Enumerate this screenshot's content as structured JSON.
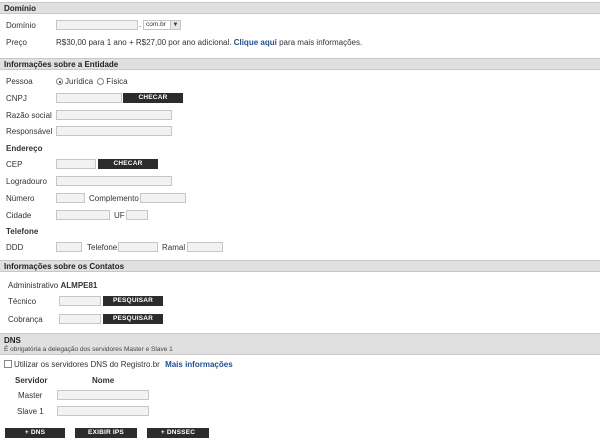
{
  "dominio": {
    "header": "Domínio",
    "label_dominio": "Domínio",
    "domain_input": "",
    "tld_select": "com.br",
    "label_preco": "Preço",
    "price_text": "R$30,00 para 1 ano + R$27,00 por ano adicional.",
    "price_link": "Clique aqui",
    "price_suffix": "para mais informações."
  },
  "entidade": {
    "header": "Informações sobre a Entidade",
    "label_pessoa": "Pessoa",
    "radio_juridica": "Jurídica",
    "radio_fisica": "Física",
    "label_cnpj": "CNPJ",
    "checar_label": "CHECAR",
    "label_razao": "Razão social",
    "label_responsavel": "Responsável",
    "endereco_title": "Endereço",
    "label_cep": "CEP",
    "label_logradouro": "Logradouro",
    "label_numero": "Número",
    "label_complemento": "Complemento",
    "label_cidade": "Cidade",
    "label_uf": "UF",
    "telefone_title": "Telefone",
    "label_ddd": "DDD",
    "label_telefone": "Telefone",
    "label_ramal": "Ramal"
  },
  "contatos": {
    "header": "Informações sobre os Contatos",
    "label_admin": "Administrativo",
    "admin_value": "ALMPE81",
    "label_tecnico": "Técnico",
    "label_cobranca": "Cobrança",
    "pesquisar_label": "PESQUISAR"
  },
  "dns": {
    "header": "DNS",
    "subtitle": "É obrigatória a delegação dos servidores Master e Slave 1",
    "use_registro_label": "Utilizar os servidores DNS do Registro.br",
    "mais_info_link": "Mais informações",
    "col_servidor": "Servidor",
    "col_nome": "Nome",
    "label_master": "Master",
    "label_slave1": "Slave 1",
    "btn_add_dns": "+ DNS",
    "btn_exibir_ips": "EXIBIR IPS",
    "btn_add_dnssec": "+ DNSSEC"
  }
}
